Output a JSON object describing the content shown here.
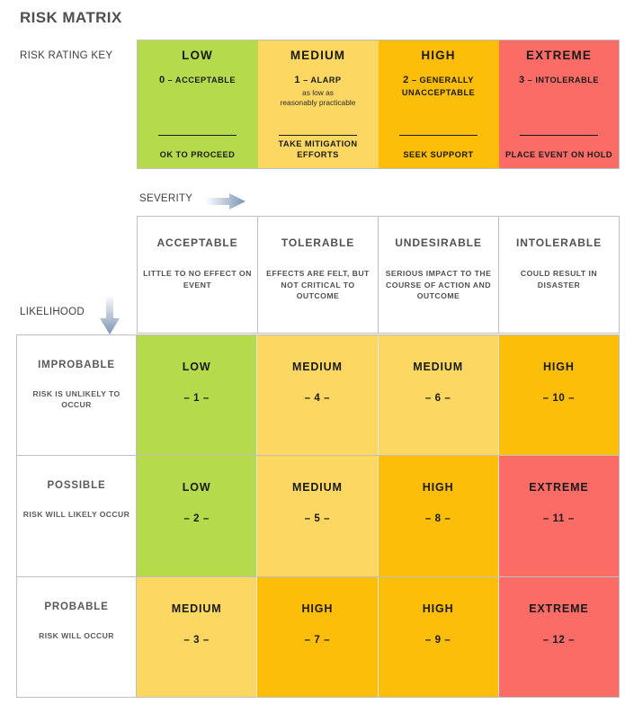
{
  "page": {
    "title": "RISK MATRIX"
  },
  "key": {
    "label": "RISK RATING KEY",
    "items": [
      {
        "title": "LOW",
        "rating_num": "0",
        "rating_text": "ACCEPTABLE",
        "sub": "",
        "action": "OK TO PROCEED",
        "color": "#B5DB4C"
      },
      {
        "title": "MEDIUM",
        "rating_num": "1",
        "rating_text": "ALARP",
        "sub": "as low as\nreasonably practicable",
        "action": "TAKE MITIGATION EFFORTS",
        "color": "#FCD862"
      },
      {
        "title": "HIGH",
        "rating_num": "2",
        "rating_text": "GENERALLY UNACCEPTABLE",
        "sub": "",
        "action": "SEEK SUPPORT",
        "color": "#FCBE08"
      },
      {
        "title": "EXTREME",
        "rating_num": "3",
        "rating_text": "INTOLERABLE",
        "sub": "",
        "action": "PLACE EVENT ON HOLD",
        "color": "#FB6C66"
      }
    ]
  },
  "axes": {
    "severity_label": "SEVERITY",
    "likelihood_label": "LIKELIHOOD",
    "arrow_color": "#7B94B5"
  },
  "matrix": {
    "severity_headers": [
      {
        "title": "ACCEPTABLE",
        "desc": "LITTLE TO NO EFFECT ON EVENT"
      },
      {
        "title": "TOLERABLE",
        "desc": "EFFECTS ARE FELT, BUT NOT CRITICAL TO OUTCOME"
      },
      {
        "title": "UNDESIRABLE",
        "desc": "SERIOUS IMPACT TO THE COURSE OF ACTION AND OUTCOME"
      },
      {
        "title": "INTOLERABLE",
        "desc": "COULD RESULT IN DISASTER"
      }
    ],
    "likelihood_rows": [
      {
        "title": "IMPROBABLE",
        "desc": "RISK IS UNLIKELY TO OCCUR"
      },
      {
        "title": "POSSIBLE",
        "desc": "RISK WILL LIKELY OCCUR"
      },
      {
        "title": "PROBABLE",
        "desc": "RISK WILL OCCUR"
      }
    ],
    "cells": [
      [
        {
          "label": "LOW",
          "score": "– 1 –",
          "color": "#B5DB4C"
        },
        {
          "label": "MEDIUM",
          "score": "– 4 –",
          "color": "#FCD862"
        },
        {
          "label": "MEDIUM",
          "score": "– 6 –",
          "color": "#FCD862"
        },
        {
          "label": "HIGH",
          "score": "– 10 –",
          "color": "#FCBE08"
        }
      ],
      [
        {
          "label": "LOW",
          "score": "– 2 –",
          "color": "#B5DB4C"
        },
        {
          "label": "MEDIUM",
          "score": "– 5 –",
          "color": "#FCD862"
        },
        {
          "label": "HIGH",
          "score": "– 8 –",
          "color": "#FCBE08"
        },
        {
          "label": "EXTREME",
          "score": "– 11 –",
          "color": "#FB6C66"
        }
      ],
      [
        {
          "label": "MEDIUM",
          "score": "– 3 –",
          "color": "#FCD862"
        },
        {
          "label": "HIGH",
          "score": "– 7 –",
          "color": "#FCBE08"
        },
        {
          "label": "HIGH",
          "score": "– 9 –",
          "color": "#FCBE08"
        },
        {
          "label": "EXTREME",
          "score": "– 12 –",
          "color": "#FB6C66"
        }
      ]
    ]
  }
}
